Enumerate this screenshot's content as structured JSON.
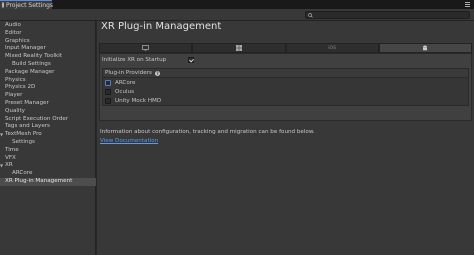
{
  "window": {
    "tab_title": "Project Settings",
    "title_icon": "gear-icon",
    "menu_icon": "kebab-menu-icon"
  },
  "search": {
    "placeholder": "",
    "icon": "search-icon"
  },
  "sidebar": {
    "items": [
      {
        "label": "Audio",
        "indent": 0,
        "expandable": false,
        "selected": false
      },
      {
        "label": "Editor",
        "indent": 0,
        "expandable": false,
        "selected": false
      },
      {
        "label": "Graphics",
        "indent": 0,
        "expandable": false,
        "selected": false
      },
      {
        "label": "Input Manager",
        "indent": 0,
        "expandable": false,
        "selected": false
      },
      {
        "label": "Mixed Reality Toolkit",
        "indent": 0,
        "expandable": false,
        "selected": false
      },
      {
        "label": "Build Settings",
        "indent": 1,
        "expandable": false,
        "selected": false
      },
      {
        "label": "Package Manager",
        "indent": 0,
        "expandable": false,
        "selected": false
      },
      {
        "label": "Physics",
        "indent": 0,
        "expandable": false,
        "selected": false
      },
      {
        "label": "Physics 2D",
        "indent": 0,
        "expandable": false,
        "selected": false
      },
      {
        "label": "Player",
        "indent": 0,
        "expandable": false,
        "selected": false
      },
      {
        "label": "Preset Manager",
        "indent": 0,
        "expandable": false,
        "selected": false
      },
      {
        "label": "Quality",
        "indent": 0,
        "expandable": false,
        "selected": false
      },
      {
        "label": "Script Execution Order",
        "indent": 0,
        "expandable": false,
        "selected": false
      },
      {
        "label": "Tags and Layers",
        "indent": 0,
        "expandable": false,
        "selected": false
      },
      {
        "label": "TextMesh Pro",
        "indent": 0,
        "expandable": true,
        "selected": false
      },
      {
        "label": "Settings",
        "indent": 1,
        "expandable": false,
        "selected": false
      },
      {
        "label": "Time",
        "indent": 0,
        "expandable": false,
        "selected": false
      },
      {
        "label": "VFX",
        "indent": 0,
        "expandable": false,
        "selected": false
      },
      {
        "label": "XR",
        "indent": 0,
        "expandable": true,
        "selected": false
      },
      {
        "label": "ARCore",
        "indent": 1,
        "expandable": false,
        "selected": false
      },
      {
        "label": "XR Plug-in Management",
        "indent": 0,
        "expandable": false,
        "selected": true
      }
    ]
  },
  "main": {
    "title": "XR Plug-in Management",
    "platform_tabs": [
      {
        "icon": "monitor-icon",
        "label": "",
        "active": false
      },
      {
        "icon": "windows-icon",
        "label": "",
        "active": false
      },
      {
        "icon": "ios-icon",
        "label": "iOS",
        "active": false
      },
      {
        "icon": "android-icon",
        "label": "",
        "active": true
      }
    ],
    "initialize_label": "Initialize XR on Startup",
    "initialize_checked": true,
    "providers_label": "Plug-in Providers",
    "providers": [
      {
        "label": "ARCore",
        "checked": false,
        "focused": true
      },
      {
        "label": "Oculus",
        "checked": false,
        "focused": false
      },
      {
        "label": "Unity Mock HMD",
        "checked": false,
        "focused": false
      }
    ],
    "info_text": "Information about configuration, tracking and migration can be found below.",
    "doc_link": "View Documentation"
  },
  "colors": {
    "link": "#5c9be6",
    "selection": "#4d4d4d",
    "focus_border": "#4a7fd0"
  }
}
